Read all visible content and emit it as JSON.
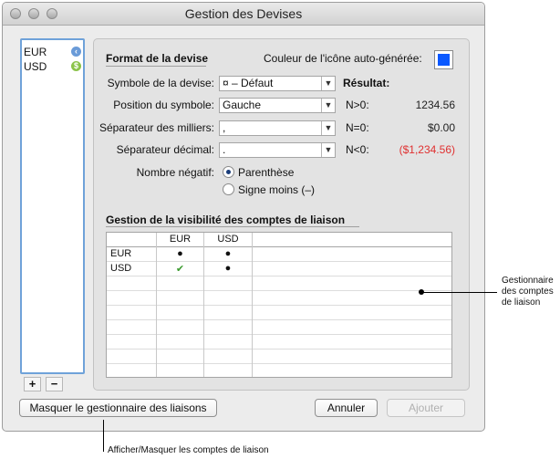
{
  "window": {
    "title": "Gestion des Devises"
  },
  "currencies": [
    {
      "code": "EUR",
      "icon": "arrow-left-circle-icon",
      "icon_color": "#6a9bd8"
    },
    {
      "code": "USD",
      "icon": "dollar-circle-icon",
      "icon_color": "#8bc34a"
    }
  ],
  "list_buttons": {
    "add": "+",
    "remove": "−"
  },
  "format": {
    "heading": "Format de la devise",
    "color_label": "Couleur de l'icône auto-générée:",
    "icon_color": "#0a58ff",
    "symbol_label": "Symbole de la devise:",
    "symbol_value": "¤ – Défaut",
    "position_label": "Position du symbole:",
    "position_value": "Gauche",
    "thousands_label": "Séparateur des milliers:",
    "thousands_value": ",",
    "decimal_label": "Séparateur décimal:",
    "decimal_value": ".",
    "negative_label": "Nombre négatif:",
    "negative_options": [
      "Parenthèse",
      "Signe moins (–)"
    ],
    "negative_selected": "Parenthèse"
  },
  "result": {
    "heading": "Résultat:",
    "rows": [
      {
        "label": "N>0:",
        "value": "1234.56",
        "color": "#222222"
      },
      {
        "label": "N=0:",
        "value": "$0.00",
        "color": "#222222"
      },
      {
        "label": "N<0:",
        "value": "($1,234.56)",
        "color": "#e03030"
      }
    ]
  },
  "visibility": {
    "heading": "Gestion de la visibilité des comptes de liaison",
    "columns": [
      "EUR",
      "USD"
    ],
    "rows": [
      {
        "label": "EUR",
        "cells": [
          "●",
          "●"
        ]
      },
      {
        "label": "USD",
        "cells": [
          "✔",
          "●"
        ]
      }
    ]
  },
  "buttons": {
    "toggle_manager": "Masquer le gestionnaire des liaisons",
    "cancel": "Annuler",
    "add": "Ajouter"
  },
  "annotations": {
    "manager": "Gestionnaire des comptes de liaison",
    "toggle": "Afficher/Masquer les comptes de liaison"
  }
}
